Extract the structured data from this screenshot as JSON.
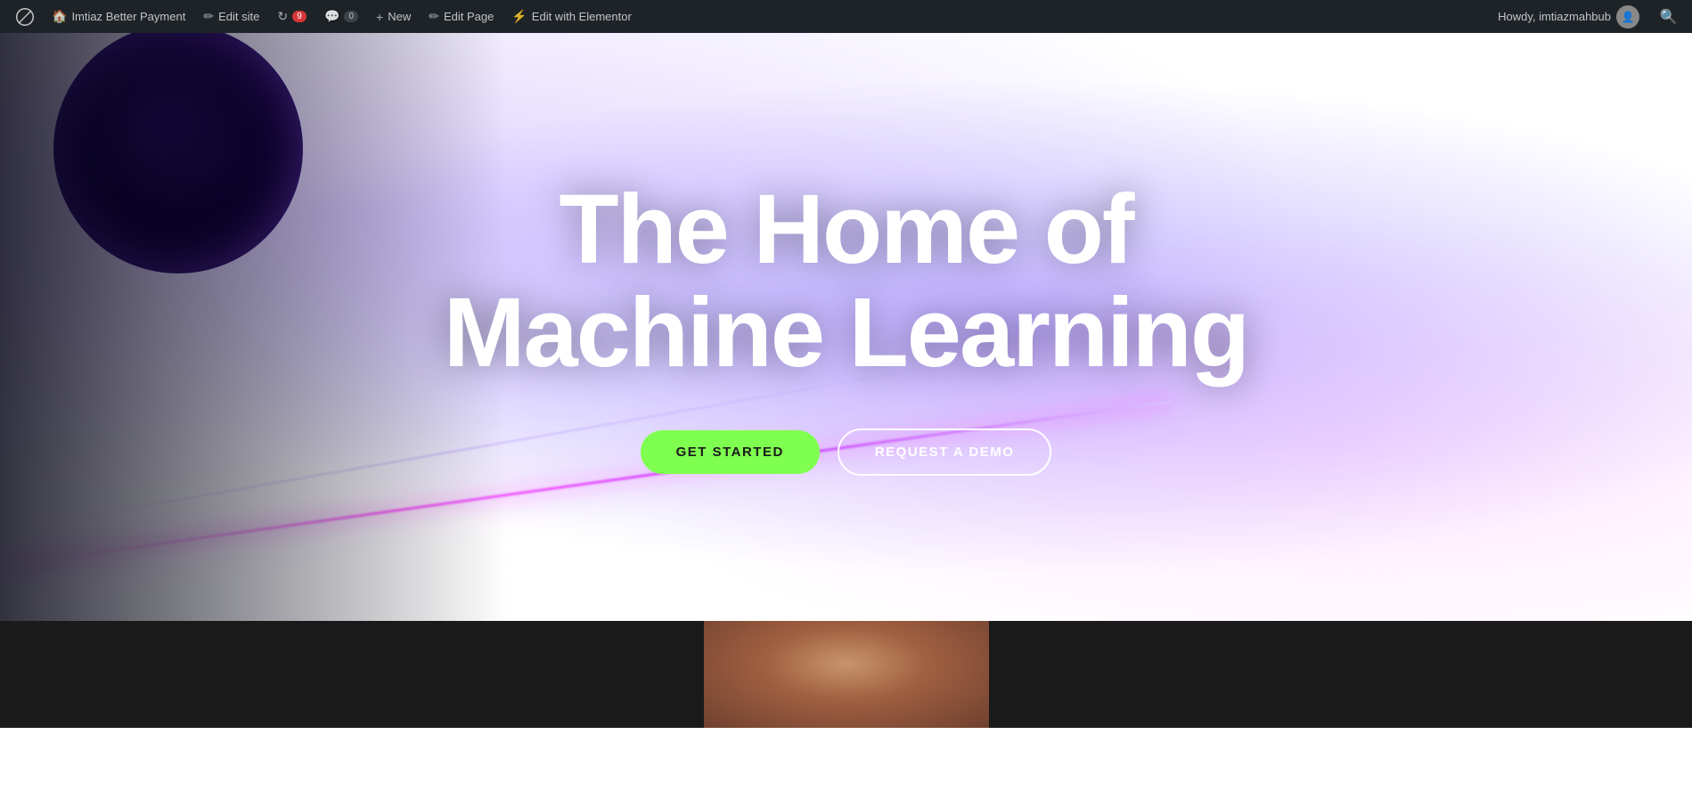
{
  "adminbar": {
    "wp_logo_title": "WordPress",
    "site_name": "Imtiaz Better Payment",
    "edit_site_label": "Edit site",
    "updates_count": "9",
    "comments_count": "0",
    "new_label": "New",
    "edit_page_label": "Edit Page",
    "edit_elementor_label": "Edit with Elementor",
    "howdy_text": "Howdy, imtiazmahbub",
    "search_title": "Search",
    "colors": {
      "bar_bg": "#1d2327",
      "text": "#c3c4c7",
      "hover_bg": "#2c3338"
    }
  },
  "hero": {
    "title_line1": "The Home of",
    "title_line2": "Machine Learning",
    "btn_get_started": "GET STARTED",
    "btn_request_demo": "REQUEST A DEMO",
    "colors": {
      "bg_primary": "#3010a0",
      "bg_secondary": "#5020d0",
      "btn_green": "#7fff50",
      "btn_text": "#1a1a1a",
      "title_color": "#ffffff"
    }
  },
  "icons": {
    "wp": "W",
    "pencil": "✏",
    "update": "↻",
    "comment": "💬",
    "plus": "+",
    "page": "📄",
    "elementor": "⚡",
    "search": "🔍",
    "user": "👤"
  }
}
